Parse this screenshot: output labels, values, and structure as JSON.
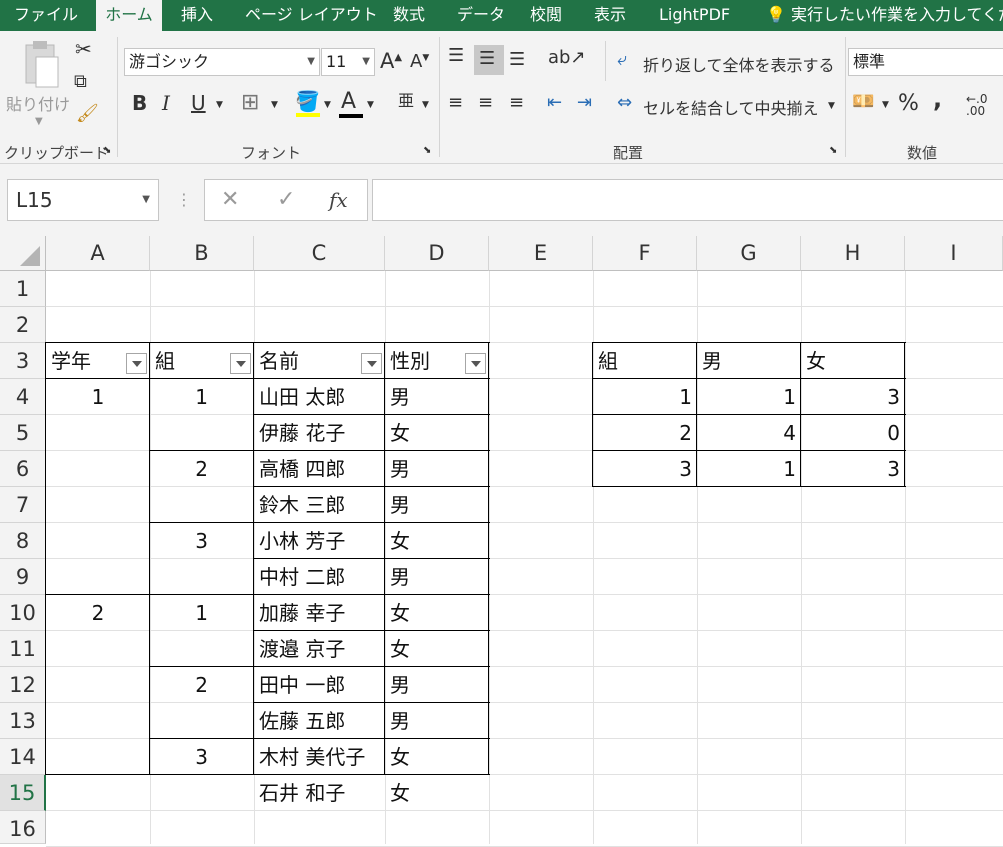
{
  "ribbon_tabs": [
    "ファイル",
    "ホーム",
    "挿入",
    "ページ レイアウト",
    "数式",
    "データ",
    "校閲",
    "表示",
    "LightPDF"
  ],
  "tell_me": "実行したい作業を入力してくだ",
  "clipboard": {
    "paste_label": "貼り付け",
    "group_label": "クリップボード"
  },
  "font": {
    "name": "游ゴシック",
    "size": "11",
    "group_label": "フォント"
  },
  "alignment": {
    "wrap_label": "折り返して全体を表示する",
    "merge_label": "セルを結合して中央揃え",
    "group_label": "配置"
  },
  "number": {
    "format": "標準",
    "group_label": "数値",
    "percent": "%",
    "comma": ","
  },
  "formula_bar": {
    "name_box": "L15",
    "fx": "fx",
    "cancel": "✕",
    "enter": "✓",
    "value": ""
  },
  "columns": [
    "A",
    "B",
    "C",
    "D",
    "E",
    "F",
    "G",
    "H",
    "I"
  ],
  "rows": [
    "1",
    "2",
    "3",
    "4",
    "5",
    "6",
    "7",
    "8",
    "9",
    "10",
    "11",
    "12",
    "13",
    "14",
    "15",
    "16"
  ],
  "active_row": "15",
  "main_table": {
    "headers": [
      "学年",
      "組",
      "名前",
      "性別"
    ],
    "grade_values": [
      "1",
      "2"
    ],
    "class_values": [
      "1",
      "2",
      "3",
      "1",
      "2",
      "3"
    ],
    "names": [
      "山田 太郎",
      "伊藤 花子",
      "高橋 四郎",
      "鈴木 三郎",
      "小林 芳子",
      "中村 二郎",
      "加藤 幸子",
      "渡邉 京子",
      "田中 一郎",
      "佐藤 五郎",
      "木村 美代子",
      "石井 和子"
    ],
    "genders": [
      "男",
      "女",
      "男",
      "男",
      "女",
      "男",
      "女",
      "女",
      "男",
      "男",
      "女",
      "女"
    ]
  },
  "summary_table": {
    "headers": [
      "組",
      "男",
      "女"
    ],
    "rows": [
      [
        "1",
        "1",
        "3"
      ],
      [
        "2",
        "4",
        "0"
      ],
      [
        "3",
        "1",
        "3"
      ]
    ]
  }
}
